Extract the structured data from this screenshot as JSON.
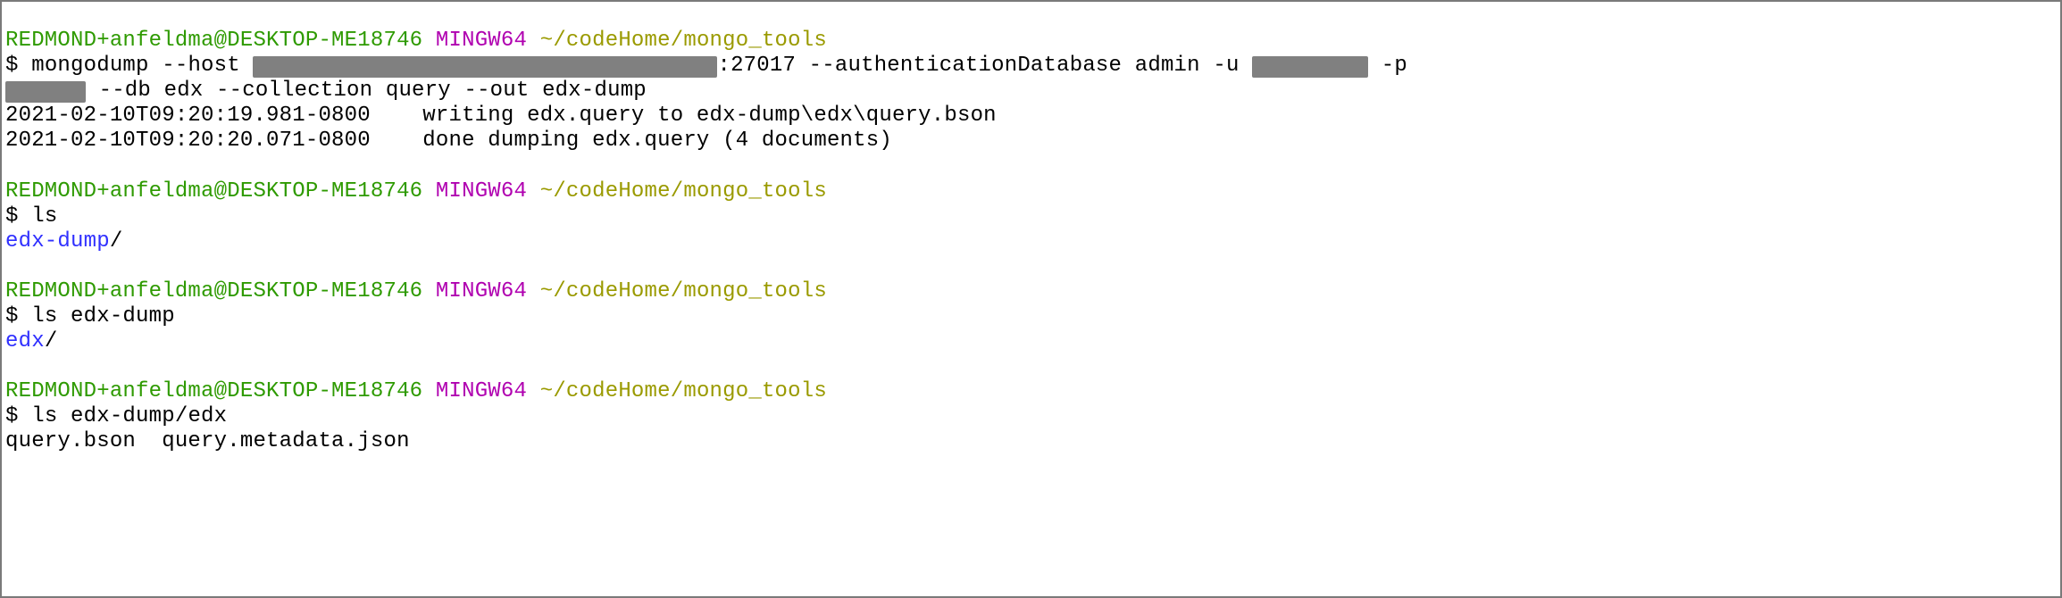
{
  "prompt": {
    "user": "REDMOND+anfeldma@DESKTOP-ME18746",
    "env": "MINGW64",
    "path": "~/codeHome/mongo_tools"
  },
  "dollar": "$ ",
  "block1": {
    "cmd_a": "mongodump --host ",
    "cmd_b": ":27017 --authenticationDatabase admin -u ",
    "cmd_c": " -p",
    "cmd_d": " --db edx --collection query --out edx-dump",
    "out1": "2021-02-10T09:20:19.981-0800    writing edx.query to edx-dump\\edx\\query.bson",
    "out2": "2021-02-10T09:20:20.071-0800    done dumping edx.query (4 documents)"
  },
  "block2": {
    "cmd": "ls",
    "out_dir": "edx-dump",
    "out_slash": "/"
  },
  "block3": {
    "cmd": "ls edx-dump",
    "out_dir": "edx",
    "out_slash": "/"
  },
  "block4": {
    "cmd": "ls edx-dump/edx",
    "out": "query.bson  query.metadata.json"
  },
  "redact_widths": {
    "host": "520px",
    "user": "130px",
    "pass": "90px"
  }
}
